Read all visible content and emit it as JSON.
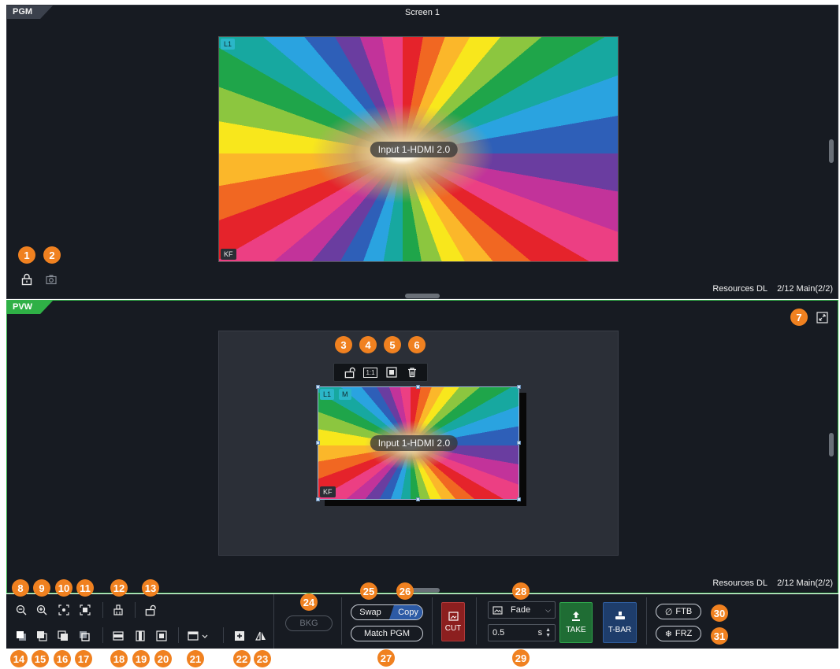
{
  "pgm": {
    "tag": "PGM",
    "screen_title": "Screen 1",
    "layer_label": "L1",
    "kf_label": "KF",
    "source_label": "Input 1-HDMI 2.0",
    "resources_label": "Resources DL",
    "resources_value": "2/12 Main(2/2)"
  },
  "pvw": {
    "tag": "PVW",
    "layer_label": "L1",
    "main_label": "M",
    "kf_label": "KF",
    "source_label": "Input 1-HDMI 2.0",
    "resources_label": "Resources DL",
    "resources_value": "2/12 Main(2/2)",
    "layer_toolbar": {
      "ratio_label": "1:1"
    }
  },
  "controls": {
    "bkg_label": "BKG",
    "swap_label": "Swap",
    "copy_label": "Copy",
    "match_pgm_label": "Match PGM",
    "cut_label": "CUT",
    "transition_effect": "Fade",
    "transition_duration": "0.5",
    "duration_unit": "s",
    "take_label": "TAKE",
    "tbar_label": "T-BAR",
    "ftb_label": "FTB",
    "frz_label": "FRZ"
  },
  "callouts": [
    "1",
    "2",
    "3",
    "4",
    "5",
    "6",
    "7",
    "8",
    "9",
    "10",
    "11",
    "12",
    "13",
    "14",
    "15",
    "16",
    "17",
    "18",
    "19",
    "20",
    "21",
    "22",
    "23",
    "24",
    "25",
    "26",
    "27",
    "28",
    "29",
    "30",
    "31"
  ],
  "colors": {
    "accent_orange": "#f08120",
    "pvw_green": "#34b34a",
    "cut_red": "#8c1f1f",
    "take_green": "#1f6d34",
    "tbar_blue": "#1e3d6b",
    "copy_blue": "#2c5aa5"
  },
  "icons": {
    "pgm_lock": "lock-icon",
    "pgm_snapshot": "camera-icon",
    "fullscreen": "fullscreen-icon"
  }
}
